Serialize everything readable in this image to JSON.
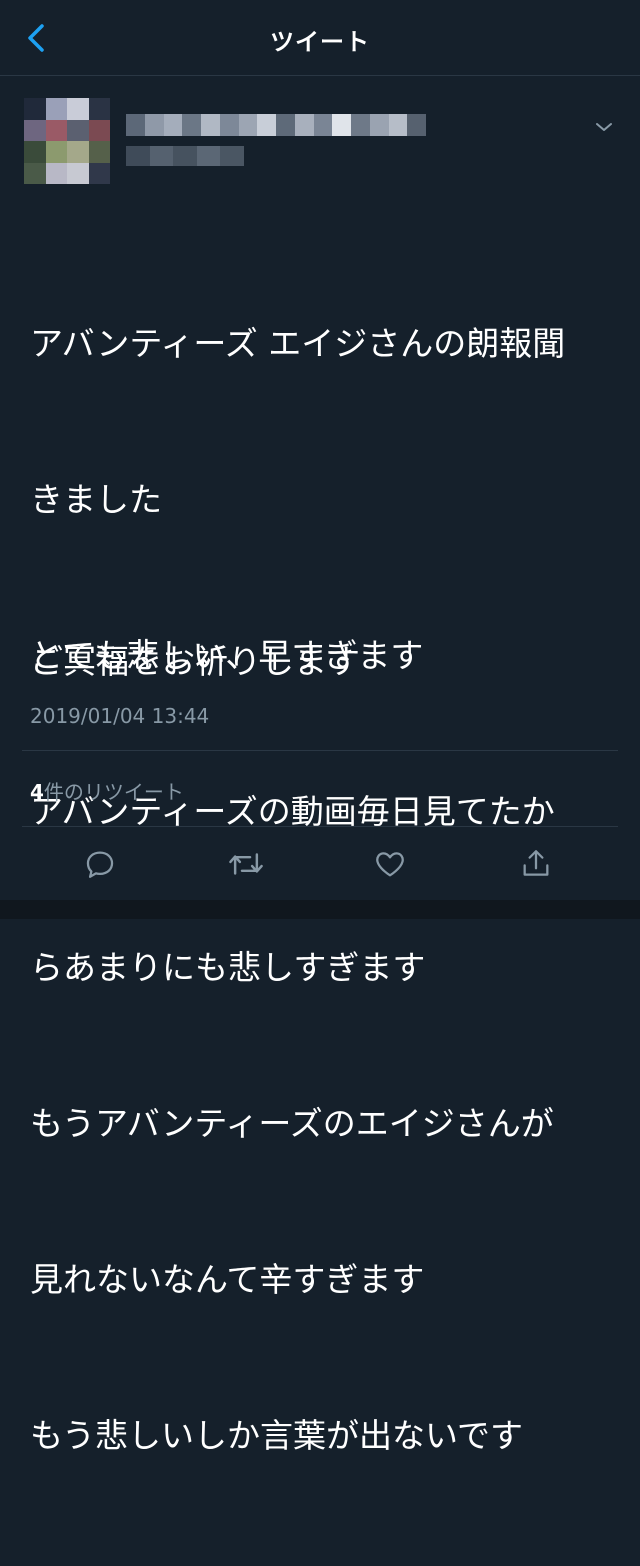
{
  "header": {
    "title": "ツイート"
  },
  "tweet": {
    "lines": [
      "アバンティーズ エイジさんの朗報聞",
      "きました",
      "とても悲しい、早すぎます",
      "アバンティーズの動画毎日見てたか",
      "らあまりにも悲しすぎます",
      "もうアバンティーズのエイジさんが",
      "見れないなんて辛すぎます",
      "もう悲しいしか言葉が出ないです"
    ],
    "closing": "ご冥福をお祈りします",
    "timestamp": "2019/01/04 13:44",
    "retweet_count": "4",
    "retweet_label": "件のリツイート"
  },
  "icons": {
    "back": "chevron-left-icon",
    "more": "chevron-down-icon",
    "reply": "reply-icon",
    "retweet": "retweet-icon",
    "like": "heart-icon",
    "share": "share-icon"
  },
  "colors": {
    "background": "#15202b",
    "accent": "#1da1f2",
    "secondary_text": "#8899a6",
    "divider": "#2a3744"
  }
}
